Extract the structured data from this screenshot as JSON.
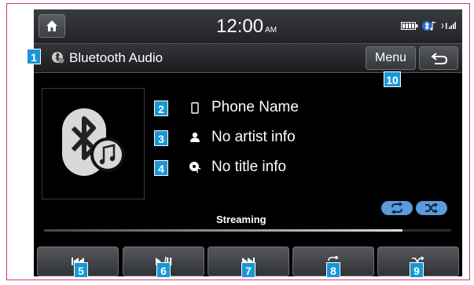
{
  "status_bar": {
    "time": "12:00",
    "ampm": "AM",
    "icons": [
      "home-icon",
      "battery-icon",
      "bluetooth-audio-icon",
      "signal-icon"
    ]
  },
  "title_bar": {
    "title": "Bluetooth Audio",
    "menu_label": "Menu"
  },
  "track_info": {
    "phone_name": "Phone Name",
    "artist": "No artist info",
    "title": "No title info"
  },
  "playback": {
    "status": "Streaming",
    "progress": 0.88
  },
  "callouts": [
    "1",
    "2",
    "3",
    "4",
    "5",
    "6",
    "7",
    "8",
    "9",
    "10"
  ],
  "colors": {
    "callout": "#1897d6",
    "frame": "#d2337f",
    "mode_icon": "#5d9ad9"
  }
}
